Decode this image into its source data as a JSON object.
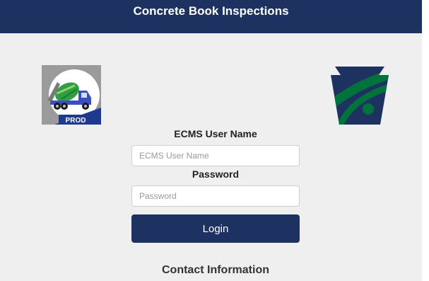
{
  "header": {
    "title": "Concrete Book Inspections"
  },
  "app_logo": {
    "badge_text": "PROD",
    "icon": "concrete-mixer-truck-icon"
  },
  "agency_logo": {
    "icon": "keystone-logo-icon"
  },
  "login_form": {
    "username_label": "ECMS User Name",
    "username_placeholder": "ECMS User Name",
    "username_value": "",
    "password_label": "Password",
    "password_placeholder": "Password",
    "password_value": "",
    "login_button_label": "Login"
  },
  "contact": {
    "heading": "Contact Information"
  },
  "colors": {
    "brand_navy": "#1d3261",
    "background": "#efefef",
    "keystone_green": "#00733c"
  }
}
